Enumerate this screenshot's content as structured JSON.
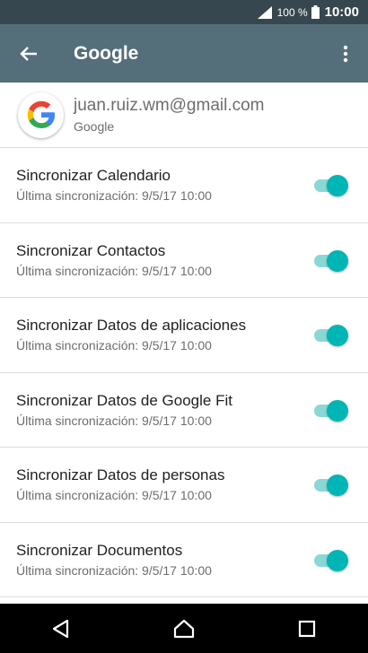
{
  "status_bar": {
    "battery_percent": "100 %",
    "time": "10:00",
    "icons": [
      "signal-icon",
      "battery-icon"
    ]
  },
  "app_bar": {
    "title": "Google",
    "back_icon": "arrow-back-icon",
    "menu_icon": "more-vert-icon",
    "color": "#546e7a"
  },
  "account": {
    "email": "juan.ruiz.wm@gmail.com",
    "provider": "Google",
    "logo_icon": "google-logo-icon"
  },
  "sync_items": [
    {
      "label": "Sincronizar Calendario",
      "sub": "Última sincronización: 9/5/17 10:00",
      "enabled": true
    },
    {
      "label": "Sincronizar Contactos",
      "sub": "Última sincronización: 9/5/17 10:00",
      "enabled": true
    },
    {
      "label": "Sincronizar Datos de aplicaciones",
      "sub": "Última sincronización: 9/5/17 10:00",
      "enabled": true
    },
    {
      "label": "Sincronizar Datos de Google Fit",
      "sub": "Última sincronización: 9/5/17 10:00",
      "enabled": true
    },
    {
      "label": "Sincronizar Datos de personas",
      "sub": "Última sincronización: 9/5/17 10:00",
      "enabled": true
    },
    {
      "label": "Sincronizar Documentos",
      "sub": "Última sincronización: 9/5/17 10:00",
      "enabled": true
    }
  ],
  "colors": {
    "toggle_on": "#00b5b5",
    "toggle_track": "#8ad8d5"
  },
  "nav_bar": {
    "icons": [
      "back-triangle-icon",
      "home-icon",
      "recents-icon"
    ]
  }
}
